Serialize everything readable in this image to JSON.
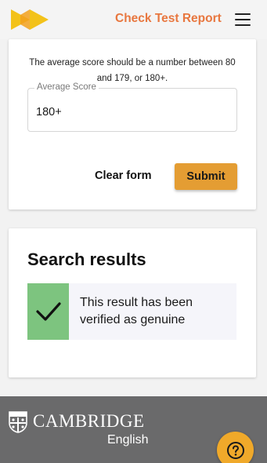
{
  "header": {
    "title": "Check Test Report",
    "accent_color": "#e8773f",
    "logo_icon": "double-arrow-logo-icon",
    "menu_icon": "hamburger-menu-icon"
  },
  "form": {
    "help_text": "The average score should be a number between 80 and 179, or 180+.",
    "field_label": "Average Score",
    "field_value": "180+",
    "clear_label": "Clear form",
    "submit_label": "Submit",
    "submit_color": "#e49d33"
  },
  "results": {
    "title": "Search results",
    "message": "This result has been verified as genuine",
    "status_icon": "check-icon",
    "status_color": "#7dc47f"
  },
  "footer": {
    "brand": "CAMBRIDGE",
    "sub": "English",
    "crest_icon": "cambridge-crest-icon"
  },
  "help_button": {
    "icon": "question-icon",
    "color": "#f0a92a"
  }
}
